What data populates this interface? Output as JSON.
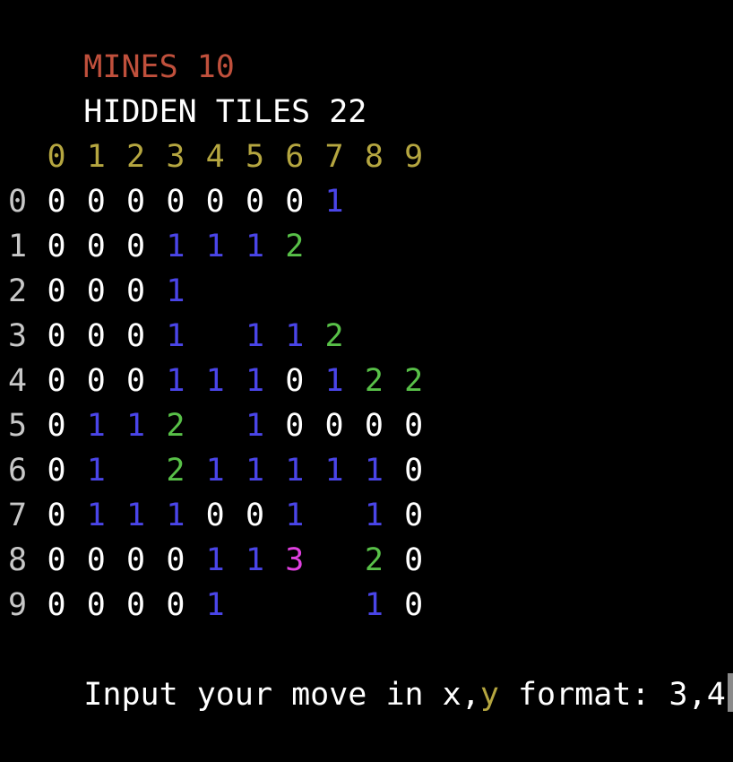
{
  "colors": {
    "background": "#000000",
    "mines": "#c0503c",
    "header": "#ffffff",
    "column_label": "#b5a640",
    "row_label": "#c8c8c8",
    "n0": "#ffffff",
    "n1": "#4a45e8",
    "n2": "#58c048",
    "n3": "#e040e0",
    "prompt": "#ffffff",
    "prompt_y": "#b5a640",
    "cursor": "#8a8a8a"
  },
  "header": {
    "mines_label": "MINES 10",
    "hidden_label": "HIDDEN TILES 22"
  },
  "columns": [
    "0",
    "1",
    "2",
    "3",
    "4",
    "5",
    "6",
    "7",
    "8",
    "9"
  ],
  "rows": [
    {
      "label": "0",
      "cells": [
        "0",
        "0",
        "0",
        "0",
        "0",
        "0",
        "0",
        "1",
        "",
        ""
      ]
    },
    {
      "label": "1",
      "cells": [
        "0",
        "0",
        "0",
        "1",
        "1",
        "1",
        "2",
        "",
        "",
        ""
      ]
    },
    {
      "label": "2",
      "cells": [
        "0",
        "0",
        "0",
        "1",
        "",
        "",
        "",
        "",
        "",
        ""
      ]
    },
    {
      "label": "3",
      "cells": [
        "0",
        "0",
        "0",
        "1",
        "",
        "1",
        "1",
        "2",
        "",
        ""
      ]
    },
    {
      "label": "4",
      "cells": [
        "0",
        "0",
        "0",
        "1",
        "1",
        "1",
        "0",
        "1",
        "2",
        "2"
      ]
    },
    {
      "label": "5",
      "cells": [
        "0",
        "1",
        "1",
        "2",
        "",
        "1",
        "0",
        "0",
        "0",
        "0"
      ]
    },
    {
      "label": "6",
      "cells": [
        "0",
        "1",
        "",
        "2",
        "1",
        "1",
        "1",
        "1",
        "1",
        "0"
      ]
    },
    {
      "label": "7",
      "cells": [
        "0",
        "1",
        "1",
        "1",
        "0",
        "0",
        "1",
        "",
        "1",
        "0"
      ]
    },
    {
      "label": "8",
      "cells": [
        "0",
        "0",
        "0",
        "0",
        "1",
        "1",
        "3",
        "",
        "2",
        "0"
      ]
    },
    {
      "label": "9",
      "cells": [
        "0",
        "0",
        "0",
        "0",
        "1",
        "",
        "",
        "",
        "1",
        "0"
      ]
    }
  ],
  "prompt": {
    "before": "Input your move in x,",
    "y": "y",
    "after": " format: ",
    "input": "3,4"
  }
}
